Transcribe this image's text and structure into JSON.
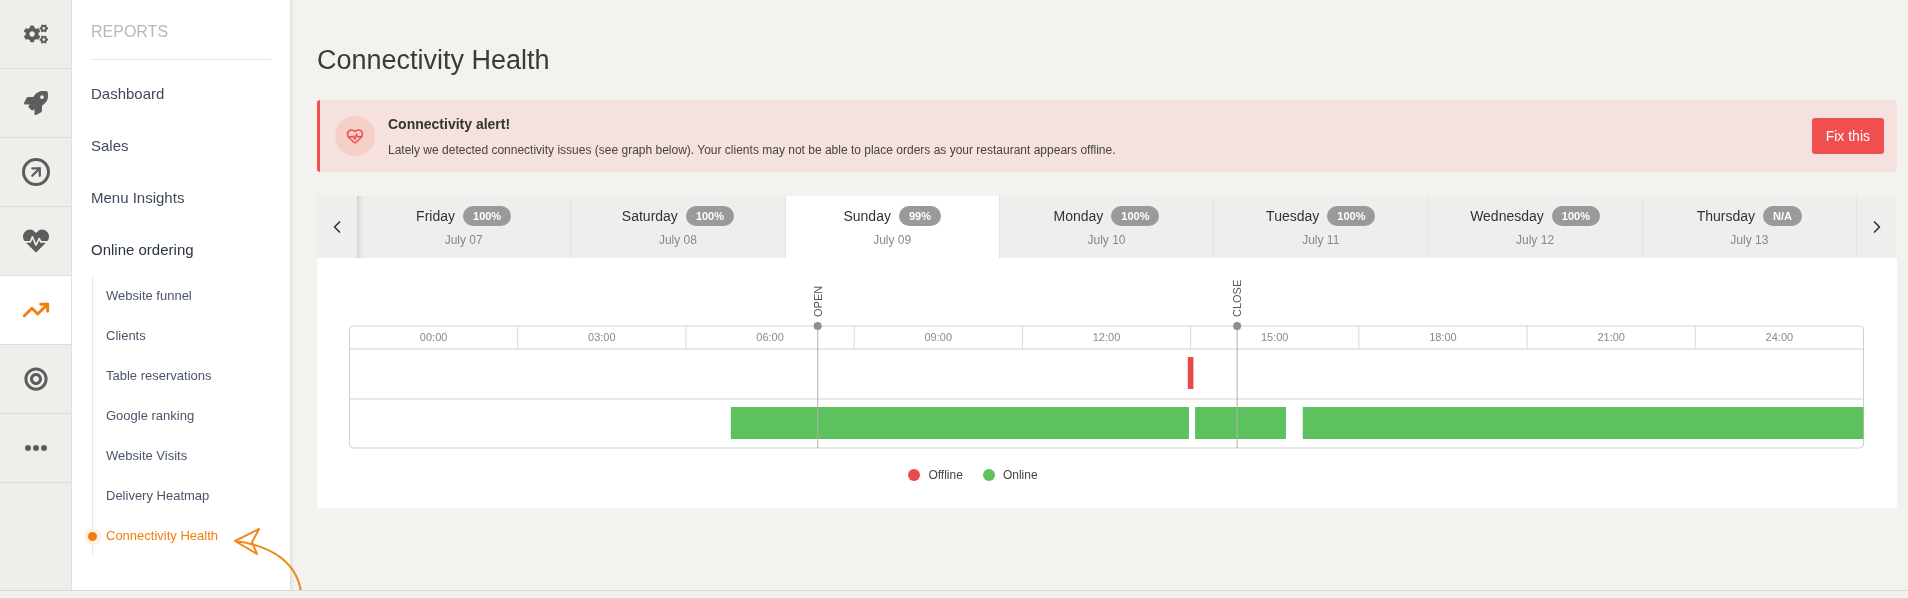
{
  "rail": [
    {
      "kind": "gears",
      "selected": false
    },
    {
      "kind": "rocket",
      "selected": false
    },
    {
      "kind": "arrow",
      "selected": false
    },
    {
      "kind": "heart",
      "selected": false
    },
    {
      "kind": "chart",
      "selected": true
    },
    {
      "kind": "target",
      "selected": false
    },
    {
      "kind": "more",
      "selected": false
    }
  ],
  "sidebar": {
    "heading": "REPORTS",
    "items": [
      {
        "label": "Dashboard",
        "selected": false
      },
      {
        "label": "Sales",
        "selected": false
      },
      {
        "label": "Menu Insights",
        "selected": false
      },
      {
        "label": "Online ordering",
        "selected": false,
        "children": [
          {
            "label": "Website funnel",
            "selected": false
          },
          {
            "label": "Clients",
            "selected": false
          },
          {
            "label": "Table reservations",
            "selected": false
          },
          {
            "label": "Google ranking",
            "selected": false
          },
          {
            "label": "Website Visits",
            "selected": false
          },
          {
            "label": "Delivery Heatmap",
            "selected": false
          },
          {
            "label": "Connectivity Health",
            "selected": true
          }
        ]
      }
    ]
  },
  "page_title": "Connectivity Health",
  "alert": {
    "title": "Connectivity alert!",
    "message": "Lately we detected connectivity issues (see graph below). Your clients may not be able to place orders as your restaurant appears offline.",
    "button": "Fix this"
  },
  "days": [
    {
      "day": "Friday",
      "badge": "100%",
      "date": "July 07",
      "selected": false
    },
    {
      "day": "Saturday",
      "badge": "100%",
      "date": "July 08",
      "selected": false
    },
    {
      "day": "Sunday",
      "badge": "99%",
      "date": "July 09",
      "selected": true
    },
    {
      "day": "Monday",
      "badge": "100%",
      "date": "July 10",
      "selected": false
    },
    {
      "day": "Tuesday",
      "badge": "100%",
      "date": "July 11",
      "selected": false
    },
    {
      "day": "Wednesday",
      "badge": "100%",
      "date": "July 12",
      "selected": false
    },
    {
      "day": "Thursday",
      "badge": "N/A",
      "date": "July 13",
      "selected": false
    }
  ],
  "timeline": {
    "ticks": [
      "00:00",
      "03:00",
      "06:00",
      "09:00",
      "12:00",
      "15:00",
      "18:00",
      "21:00",
      "24:00"
    ],
    "markers": [
      "OPEN",
      "CLOSE"
    ],
    "legend": [
      {
        "label": "Offline",
        "color": "#e84b4b"
      },
      {
        "label": "Online",
        "color": "#5cc15e"
      }
    ]
  }
}
